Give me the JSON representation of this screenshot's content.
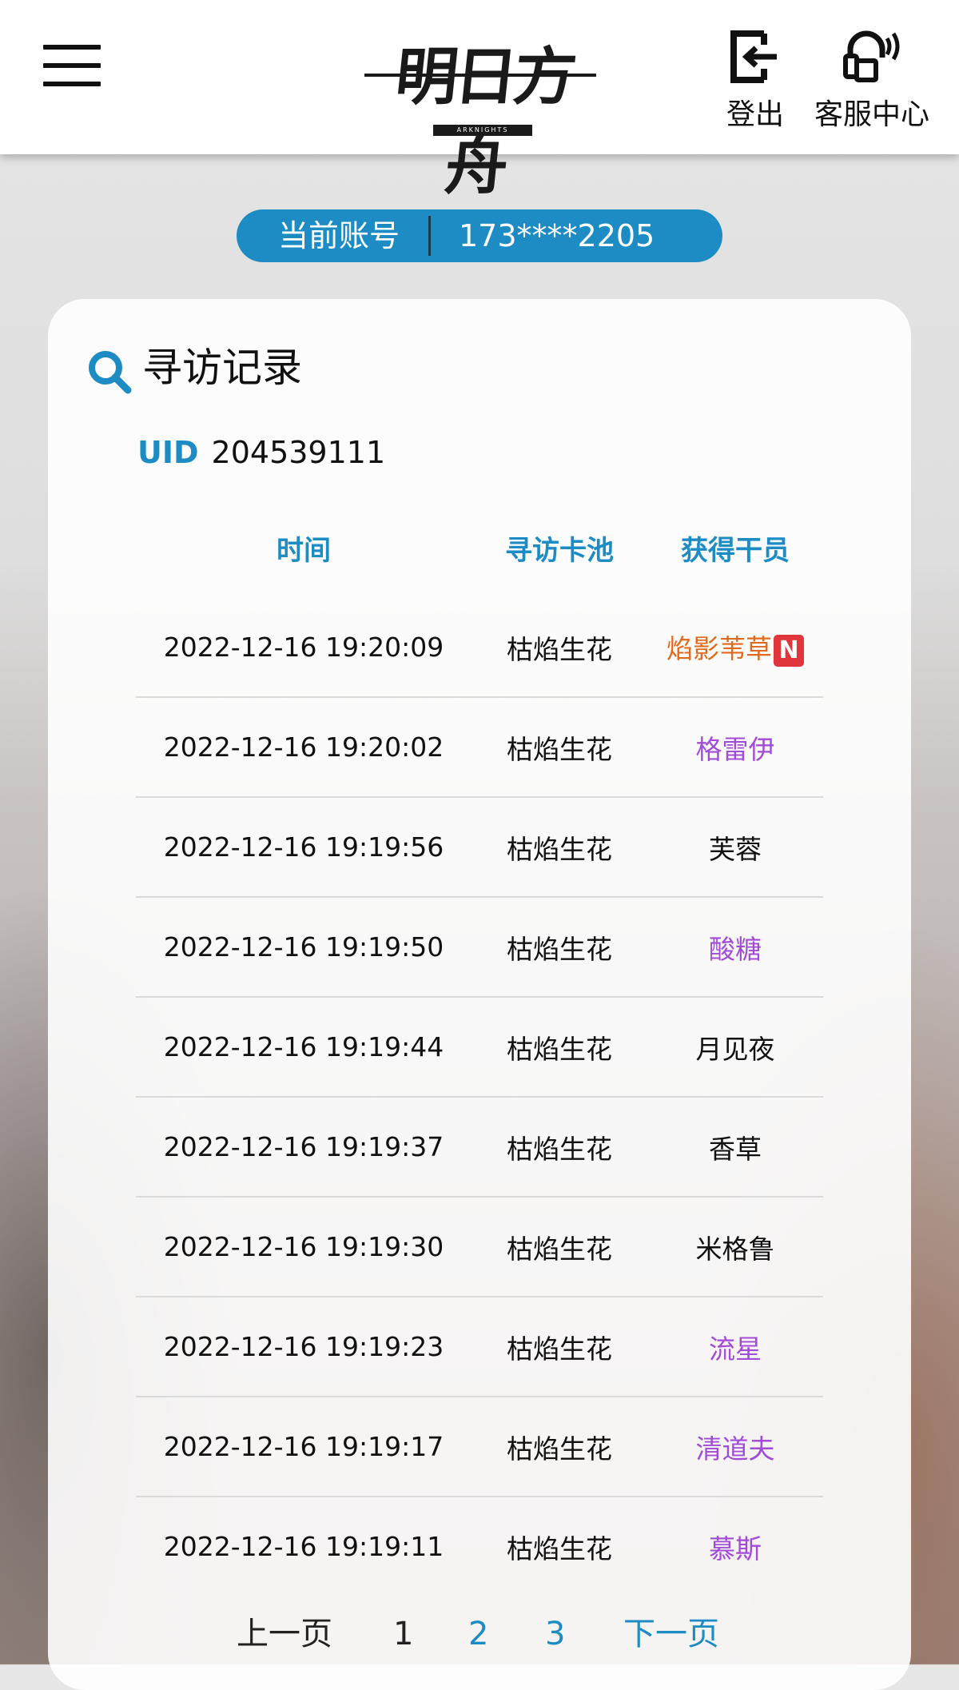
{
  "header": {
    "logo_text": "明日方舟",
    "logo_sub": "ARKNIGHTS",
    "logout_label": "登出",
    "service_label": "客服中心"
  },
  "account": {
    "label": "当前账号",
    "value": "173****2205"
  },
  "record": {
    "title": "寻访记录",
    "uid_label": "UID",
    "uid_value": "204539111",
    "columns": [
      "时间",
      "寻访卡池",
      "获得干员"
    ],
    "rows": [
      {
        "time": "2022-12-16 19:20:09",
        "pool": "枯焰生花",
        "operator": "焰影苇草",
        "operator_color": "#e06a1e",
        "new": true
      },
      {
        "time": "2022-12-16 19:20:02",
        "pool": "枯焰生花",
        "operator": "格雷伊",
        "operator_color": "#a14bd6",
        "new": false
      },
      {
        "time": "2022-12-16 19:19:56",
        "pool": "枯焰生花",
        "operator": "芙蓉",
        "operator_color": "#111111",
        "new": false
      },
      {
        "time": "2022-12-16 19:19:50",
        "pool": "枯焰生花",
        "operator": "酸糖",
        "operator_color": "#a14bd6",
        "new": false
      },
      {
        "time": "2022-12-16 19:19:44",
        "pool": "枯焰生花",
        "operator": "月见夜",
        "operator_color": "#111111",
        "new": false
      },
      {
        "time": "2022-12-16 19:19:37",
        "pool": "枯焰生花",
        "operator": "香草",
        "operator_color": "#111111",
        "new": false
      },
      {
        "time": "2022-12-16 19:19:30",
        "pool": "枯焰生花",
        "operator": "米格鲁",
        "operator_color": "#111111",
        "new": false
      },
      {
        "time": "2022-12-16 19:19:23",
        "pool": "枯焰生花",
        "operator": "流星",
        "operator_color": "#a14bd6",
        "new": false
      },
      {
        "time": "2022-12-16 19:19:17",
        "pool": "枯焰生花",
        "operator": "清道夫",
        "operator_color": "#a14bd6",
        "new": false
      },
      {
        "time": "2022-12-16 19:19:11",
        "pool": "枯焰生花",
        "operator": "慕斯",
        "operator_color": "#a14bd6",
        "new": false
      }
    ],
    "new_badge": "N"
  },
  "pager": {
    "prev": "上一页",
    "pages": [
      "1",
      "2",
      "3"
    ],
    "current": "1",
    "next": "下一页"
  },
  "colors": {
    "accent": "#1d8cc4",
    "new_badge": "#e0353b"
  }
}
